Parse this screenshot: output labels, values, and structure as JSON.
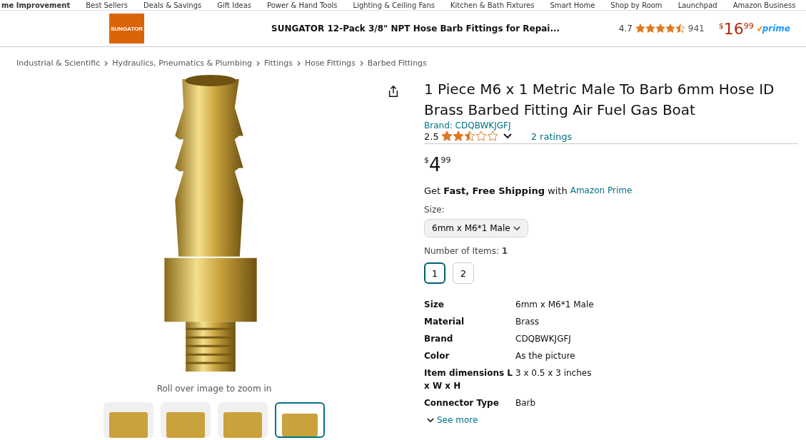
{
  "nav": [
    "me Improvement",
    "Best Sellers",
    "Deals & Savings",
    "Gift Ideas",
    "Power & Hand Tools",
    "Lighting & Ceiling Fans",
    "Kitchen & Bath Fixtures",
    "Smart Home",
    "Shop by Room",
    "Launchpad",
    "Amazon Business"
  ],
  "sticky": {
    "logo": "SUNGATOR",
    "title": "SUNGATOR 12-Pack 3/8\" NPT Hose Barb Fittings for Repai...",
    "rating": "4.7",
    "stars": 4.5,
    "count": "941",
    "currency": "$",
    "price_whole": "16",
    "price_fraction": "99",
    "prime": "prime"
  },
  "breadcrumb": [
    "Industrial & Scientific",
    "Hydraulics, Pneumatics & Plumbing",
    "Fittings",
    "Hose Fittings",
    "Barbed Fittings"
  ],
  "gallery": {
    "hint": "Roll over image to zoom in",
    "thumbnails": [
      {
        "selected": false
      },
      {
        "selected": false
      },
      {
        "selected": false
      },
      {
        "selected": true
      }
    ]
  },
  "product": {
    "title": "1 Piece M6 x 1 Metric Male To Barb 6mm Hose ID Brass Barbed Fitting Air Fuel Gas Boat",
    "brand": "Brand: CDQBWKJGFJ",
    "rating": "2.5",
    "stars": 2.5,
    "ratings": "2 ratings",
    "currency": "$",
    "price_whole": "4",
    "price_fraction": "99",
    "shipping": "Get **Fast, Free Shipping** with",
    "shipping_link": "Amazon Prime",
    "size_label": "Size:",
    "size_value": "6mm x M6*1 Male",
    "items_label": "Number of Items: **1**",
    "item_options": [
      {
        "label": "1",
        "selected": true
      },
      {
        "label": "2",
        "selected": false
      }
    ],
    "specs": [
      {
        "name": "Size",
        "value": "6mm x M6*1 Male"
      },
      {
        "name": "Material",
        "value": "Brass"
      },
      {
        "name": "Brand",
        "value": "CDQBWKJGFJ"
      },
      {
        "name": "Color",
        "value": "As the picture"
      },
      {
        "name": "Item dimensions L x W x H",
        "value": "3 x 0.5 x 3 inches"
      },
      {
        "name": "Connector Type",
        "value": "Barb"
      }
    ],
    "see_more": "See more"
  }
}
